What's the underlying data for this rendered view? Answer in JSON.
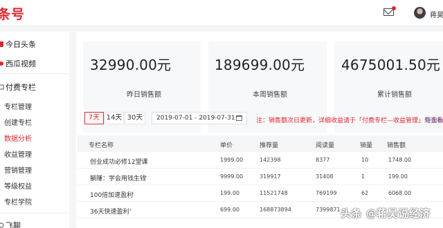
{
  "header": {
    "logo": "条号",
    "user_name": "蒋昊",
    "accent": "#e0262e"
  },
  "sidebar": {
    "items": [
      {
        "label": "今日头条",
        "icon": "toutiao-icon"
      },
      {
        "label": "西瓜视频",
        "icon": "xigua-icon"
      },
      {
        "label": "付费专栏",
        "icon": "column-icon"
      }
    ],
    "sub_items": [
      {
        "label": "专栏管理"
      },
      {
        "label": "创建专栏"
      },
      {
        "label": "数据分析",
        "active": true
      },
      {
        "label": "收益管理"
      },
      {
        "label": "营销管理"
      },
      {
        "label": "等级权益"
      },
      {
        "label": "专栏学院"
      }
    ],
    "bottom_item": {
      "label": "飞聊"
    }
  },
  "stats": [
    {
      "value": "32990.00元",
      "caption": "昨日销售额"
    },
    {
      "value": "189699.00元",
      "caption": "本周销售额"
    },
    {
      "value": "4675001.50元",
      "caption": "累计销售额"
    }
  ],
  "filters": {
    "ranges": [
      "7天",
      "14天",
      "30天"
    ],
    "active_range": "7天",
    "date_range": "2019-07-01  -  2019-07-31",
    "note": "注：销售额次日更新，详细收益请于「付费专栏—收益管理」处查看",
    "export_label": "导出Ex"
  },
  "table": {
    "headers": [
      "专栏名称",
      "单价",
      "推荐量",
      "阅读量",
      "销量",
      "销售额"
    ],
    "rows": [
      {
        "name": "创业成功必修12堂课",
        "price": "1999.00",
        "recommend": "142398",
        "reads": "8377",
        "sales": "10",
        "revenue": "1748.00"
      },
      {
        "name": "躺赚：学会用钱生钱",
        "price": "9999.00",
        "recommend": "319917",
        "reads": "31408",
        "sales": "1",
        "revenue": "199.00"
      },
      {
        "name": "100倍加速盈利",
        "price": "199.00",
        "recommend": "11521748",
        "reads": "769199",
        "sales": "62",
        "revenue": "6068.00"
      },
      {
        "name": "36天快速盈利",
        "price": "699.00",
        "recommend": "168873894",
        "reads": "7399871",
        "sales": "",
        "revenue": ""
      }
    ]
  },
  "watermark": "头条 @蒋昊说经济"
}
